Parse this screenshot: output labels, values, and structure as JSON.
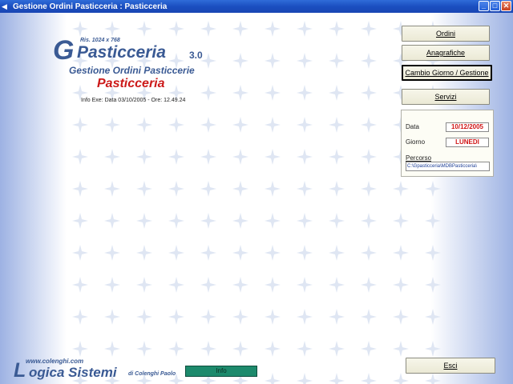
{
  "window": {
    "title": "Gestione Ordini Pasticceria : Pasticceria",
    "controls": [
      "minimize",
      "maximize",
      "close"
    ]
  },
  "logo": {
    "g_letter": "G",
    "name": "Pasticceria",
    "version": "3.0",
    "resolution": "Ris. 1024 x 768"
  },
  "subtitle": "Gestione Ordini Pasticcerie",
  "section_title": "Pasticceria",
  "info_exe": "Info Exe: Data 03/10/2005 - Ore: 12.49.24",
  "buttons": {
    "ordini": "Ordini",
    "anagrafiche": "Anagrafiche",
    "cambio": "Cambio Giorno / Gestione",
    "servizi": "Servizi",
    "esci": "Esci",
    "info": "Info"
  },
  "info_panel": {
    "data_label": "Data",
    "data_value": "10/12/2005",
    "giorno_label": "Giorno",
    "giorno_value": "LUNEDI",
    "percorso_label": "Percorso",
    "percorso_value": "C:\\Gpasticceria\\MDBPasticceria\\"
  },
  "footer": {
    "website": "www.colenghi.com",
    "brand_first": "L",
    "brand_rest": "ogica Sistemi",
    "brand_by": "di Colenghi Paolo"
  },
  "colors": {
    "titlebar": "#1b4fc0",
    "logo_blue": "#3a5a94",
    "accent_red": "#cc1a1a",
    "info_button": "#1d8a6c"
  }
}
